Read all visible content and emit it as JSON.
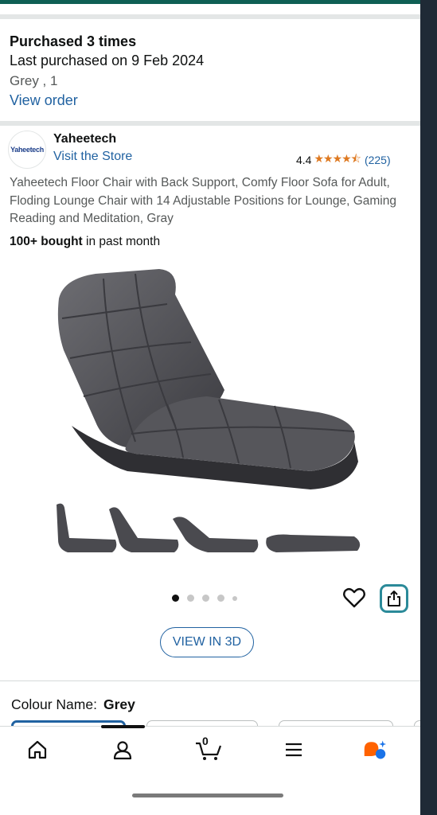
{
  "purchase": {
    "times": "Purchased 3 times",
    "last": "Last purchased on 9 Feb 2024",
    "variant": "Grey , 1",
    "view_order": "View order"
  },
  "brand": {
    "logo_text": "Yaheetech",
    "name": "Yaheetech",
    "visit_store": "Visit the Store"
  },
  "rating": {
    "value": "4.4",
    "stars": "★★★★⯪",
    "count": "(225)"
  },
  "product": {
    "title": "Yaheetech Floor Chair with Back Support, Comfy Floor Sofa for Adult, Floding Lounge Chair with 14 Adjustable Positions for Lounge, Gaming Reading and Meditation, Gray",
    "bought_bold": "100+ bought",
    "bought_rest": " in past month",
    "view3d": "VIEW IN 3D",
    "carousel_index": 1,
    "carousel_total": 5
  },
  "colour": {
    "label": "Colour Name:",
    "value": "Grey"
  },
  "nav": {
    "cart_count": "0",
    "items": [
      "home-icon",
      "account-icon",
      "cart-icon",
      "menu-icon",
      "rufus-icon"
    ]
  },
  "colors": {
    "link": "#2162a1",
    "star": "#de7921",
    "share_border": "#2b8a99",
    "rufus_orange": "#ff6200",
    "rufus_blue": "#1a73e8"
  }
}
